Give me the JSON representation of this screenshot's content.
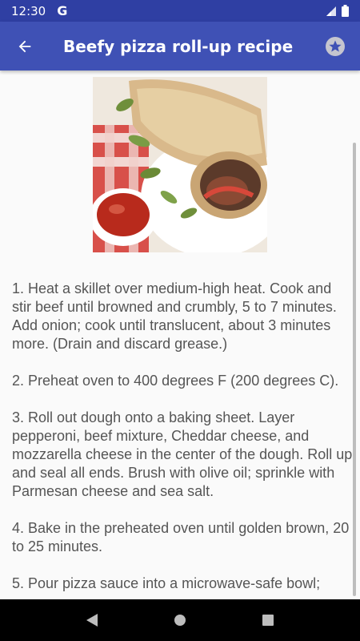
{
  "status_bar": {
    "time": "12:30",
    "app_icon": "google-g-icon",
    "icons": [
      "signal-icon",
      "battery-icon"
    ]
  },
  "app_bar": {
    "title": "Beefy pizza roll-up recipe",
    "back_icon": "arrow-back-icon",
    "favorite_icon": "star-icon",
    "color": "#3f51b5",
    "status_color": "#2f3fa3"
  },
  "recipe": {
    "image_icon": "pizza-roll-photo",
    "steps_text": "1. Heat a skillet over medium-high heat. Cook and stir beef until browned and crumbly, 5 to 7 minutes. Add onion; cook until translucent, about 3 minutes more. (Drain and discard grease.)\n\n2. Preheat oven to 400 degrees F (200 degrees C).\n\n3. Roll out dough onto a baking sheet. Layer pepperoni, beef mixture, Cheddar cheese, and mozzarella cheese in the center of the dough. Roll up and seal all ends. Brush with olive oil; sprinkle with Parmesan cheese and sea salt.\n\n4. Bake in the preheated oven until golden brown, 20 to 25 minutes.\n\n5. Pour pizza sauce into a microwave-safe bowl;"
  },
  "nav_bar": {
    "back_icon": "nav-back-icon",
    "home_icon": "nav-home-icon",
    "recents_icon": "nav-recents-icon"
  }
}
